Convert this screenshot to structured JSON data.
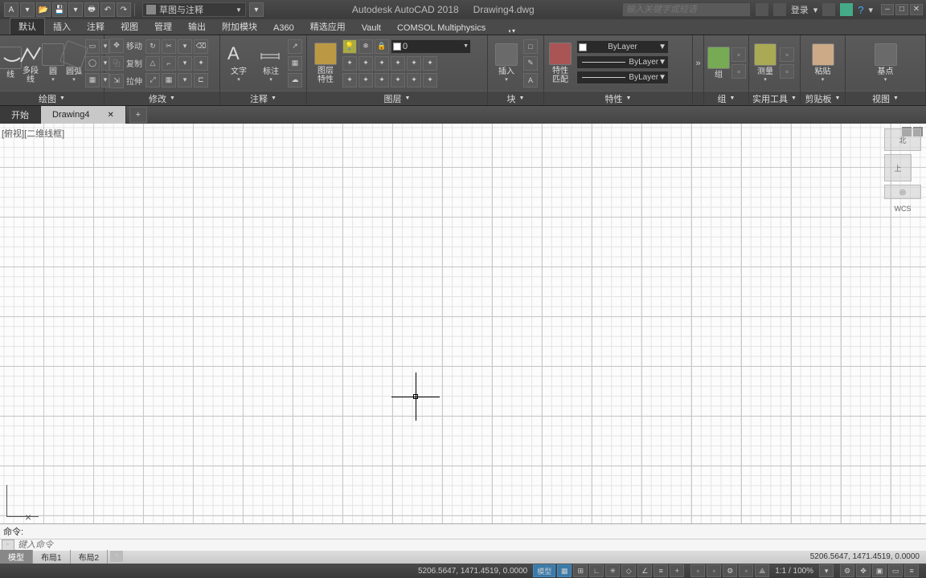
{
  "title": {
    "app": "Autodesk AutoCAD 2018",
    "doc": "Drawing4.dwg"
  },
  "search_placeholder": "输入关键字或短语",
  "login_label": "登录",
  "workspace": {
    "label": "草图与注释"
  },
  "menutabs": [
    "默认",
    "插入",
    "注释",
    "视图",
    "管理",
    "输出",
    "附加模块",
    "A360",
    "精选应用",
    "Vault",
    "COMSOL Multiphysics"
  ],
  "ribbon": {
    "draw": {
      "title": "绘图",
      "polyline": "多段线",
      "circle": "圆",
      "arc": "圆弧"
    },
    "modify": {
      "title": "修改",
      "move": "移动",
      "copy": "复制",
      "stretch": "拉伸"
    },
    "annot": {
      "title": "注释",
      "text": "文字",
      "dim": "标注"
    },
    "layer": {
      "title": "图层",
      "props": "图层\n特性",
      "current": "0"
    },
    "insert": {
      "title": "块",
      "btn": "插入"
    },
    "props": {
      "title": "特性",
      "match": "特性\n匹配",
      "bylayer": "ByLayer"
    },
    "group": {
      "title": "组",
      "btn": "组"
    },
    "util": {
      "title": "实用工具",
      "measure": "测量"
    },
    "clip": {
      "title": "剪贴板",
      "paste": "粘贴"
    },
    "view": {
      "title": "视图",
      "base": "基点"
    }
  },
  "doctabs": {
    "start": "开始",
    "active": "Drawing4"
  },
  "viewport_label": "[俯视][二维线框]",
  "navcube": {
    "north": "北",
    "top": "上",
    "wcs": "WCS"
  },
  "cmd": {
    "history": "命令:",
    "placeholder": "键入命令"
  },
  "layouts": {
    "model": "模型",
    "l1": "布局1",
    "l2": "布局2"
  },
  "status": {
    "coords": "5206.5647, 1471.4519, 0.0000",
    "model": "模型",
    "zoom": "1:1 / 100%"
  }
}
